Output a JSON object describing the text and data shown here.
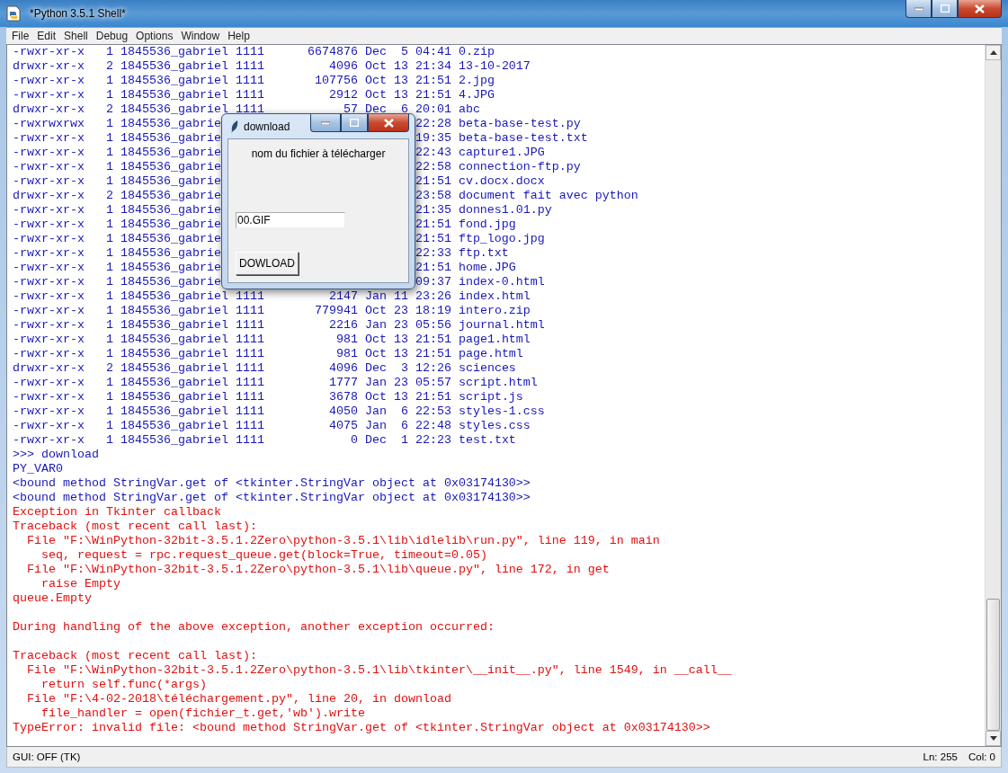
{
  "window": {
    "title": "*Python 3.5.1 Shell*"
  },
  "menu": [
    "File",
    "Edit",
    "Shell",
    "Debug",
    "Options",
    "Window",
    "Help"
  ],
  "shell": {
    "lines": [
      {
        "kind": "stdout",
        "text": "-rwxr-xr-x   1 1845536_gabriel 1111      6674876 Dec  5 04:41 0.zip"
      },
      {
        "kind": "stdout",
        "text": "drwxr-xr-x   2 1845536_gabriel 1111         4096 Oct 13 21:34 13-10-2017"
      },
      {
        "kind": "stdout",
        "text": "-rwxr-xr-x   1 1845536_gabriel 1111       107756 Oct 13 21:51 2.jpg"
      },
      {
        "kind": "stdout",
        "text": "-rwxr-xr-x   1 1845536_gabriel 1111         2912 Oct 13 21:51 4.JPG"
      },
      {
        "kind": "stdout",
        "text": "drwxr-xr-x   2 1845536_gabriel 1111           57 Dec  6 20:01 abc"
      },
      {
        "kind": "stdout",
        "segments": [
          "-rwxrwxrwx   1 1845536_gabrie",
          "22:28 beta-base-test.py"
        ]
      },
      {
        "kind": "stdout",
        "segments": [
          "-rwxr-xr-x   1 1845536_gabrie",
          "19:35 beta-base-test.txt"
        ]
      },
      {
        "kind": "stdout",
        "segments": [
          "-rwxr-xr-x   1 1845536_gabrie",
          "22:43 capture1.JPG"
        ]
      },
      {
        "kind": "stdout",
        "segments": [
          "-rwxr-xr-x   1 1845536_gabrie",
          "22:58 connection-ftp.py"
        ]
      },
      {
        "kind": "stdout",
        "segments": [
          "-rwxr-xr-x   1 1845536_gabrie",
          "21:51 cv.docx.docx"
        ]
      },
      {
        "kind": "stdout",
        "segments": [
          "drwxr-xr-x   2 1845536_gabrie",
          "23:58 document fait avec python"
        ]
      },
      {
        "kind": "stdout",
        "segments": [
          "-rwxr-xr-x   1 1845536_gabrie",
          "21:35 donnes1.01.py"
        ]
      },
      {
        "kind": "stdout",
        "segments": [
          "-rwxr-xr-x   1 1845536_gabrie",
          "21:51 fond.jpg"
        ]
      },
      {
        "kind": "stdout",
        "segments": [
          "-rwxr-xr-x   1 1845536_gabrie",
          "21:51 ftp_logo.jpg"
        ]
      },
      {
        "kind": "stdout",
        "segments": [
          "-rwxr-xr-x   1 1845536_gabrie",
          "22:33 ftp.txt"
        ]
      },
      {
        "kind": "stdout",
        "segments": [
          "-rwxr-xr-x   1 1845536_gabrie",
          "21:51 home.JPG"
        ]
      },
      {
        "kind": "stdout",
        "segments": [
          "-rwxr-xr-x   1 1845536_gabrie",
          "09:37 index-0.html"
        ]
      },
      {
        "kind": "stdout",
        "text": "-rwxr-xr-x   1 1845536_gabriel 1111         2147 Jan 11 23:26 index.html"
      },
      {
        "kind": "stdout",
        "text": "-rwxr-xr-x   1 1845536_gabriel 1111       779941 Oct 23 18:19 intero.zip"
      },
      {
        "kind": "stdout",
        "text": "-rwxr-xr-x   1 1845536_gabriel 1111         2216 Jan 23 05:56 journal.html"
      },
      {
        "kind": "stdout",
        "text": "-rwxr-xr-x   1 1845536_gabriel 1111          981 Oct 13 21:51 page1.html"
      },
      {
        "kind": "stdout",
        "text": "-rwxr-xr-x   1 1845536_gabriel 1111          981 Oct 13 21:51 page.html"
      },
      {
        "kind": "stdout",
        "text": "drwxr-xr-x   2 1845536_gabriel 1111         4096 Dec  3 12:26 sciences"
      },
      {
        "kind": "stdout",
        "text": "-rwxr-xr-x   1 1845536_gabriel 1111         1777 Jan 23 05:57 script.html"
      },
      {
        "kind": "stdout",
        "text": "-rwxr-xr-x   1 1845536_gabriel 1111         3678 Oct 13 21:51 script.js"
      },
      {
        "kind": "stdout",
        "text": "-rwxr-xr-x   1 1845536_gabriel 1111         4050 Jan  6 22:53 styles-1.css"
      },
      {
        "kind": "stdout",
        "text": "-rwxr-xr-x   1 1845536_gabriel 1111         4075 Jan  6 22:48 styles.css"
      },
      {
        "kind": "stdout",
        "text": "-rwxr-xr-x   1 1845536_gabriel 1111            0 Dec  1 22:23 test.txt"
      },
      {
        "kind": "prompt",
        "text": ">>> download"
      },
      {
        "kind": "stdout",
        "text": "PY_VAR0"
      },
      {
        "kind": "stdout",
        "text": "<bound method StringVar.get of <tkinter.StringVar object at 0x03174130>>"
      },
      {
        "kind": "stdout",
        "text": "<bound method StringVar.get of <tkinter.StringVar object at 0x03174130>>"
      },
      {
        "kind": "stderr",
        "text": "Exception in Tkinter callback"
      },
      {
        "kind": "stderr",
        "text": "Traceback (most recent call last):"
      },
      {
        "kind": "stderr",
        "text": "  File \"F:\\WinPython-32bit-3.5.1.2Zero\\python-3.5.1\\lib\\idlelib\\run.py\", line 119, in main"
      },
      {
        "kind": "stderr",
        "text": "    seq, request = rpc.request_queue.get(block=True, timeout=0.05)"
      },
      {
        "kind": "stderr",
        "text": "  File \"F:\\WinPython-32bit-3.5.1.2Zero\\python-3.5.1\\lib\\queue.py\", line 172, in get"
      },
      {
        "kind": "stderr",
        "text": "    raise Empty"
      },
      {
        "kind": "stderr",
        "text": "queue.Empty"
      },
      {
        "kind": "blank"
      },
      {
        "kind": "stderr",
        "text": "During handling of the above exception, another exception occurred:"
      },
      {
        "kind": "blank"
      },
      {
        "kind": "stderr",
        "text": "Traceback (most recent call last):"
      },
      {
        "kind": "stderr",
        "text": "  File \"F:\\WinPython-32bit-3.5.1.2Zero\\python-3.5.1\\lib\\tkinter\\__init__.py\", line 1549, in __call__"
      },
      {
        "kind": "stderr",
        "text": "    return self.func(*args)"
      },
      {
        "kind": "stderr",
        "text": "  File \"F:\\4-02-2018\\téléchargement.py\", line 20, in download"
      },
      {
        "kind": "stderr",
        "text": "    file_handler = open(fichier_t.get,'wb').write"
      },
      {
        "kind": "stderr",
        "text": "TypeError: invalid file: <bound method StringVar.get of <tkinter.StringVar object at 0x03174130>>"
      }
    ]
  },
  "dialog": {
    "title": "download",
    "label": "nom du fichier à télécharger",
    "input_value": "00.GIF",
    "button": "DOWLOAD"
  },
  "status_bar": {
    "left": "GUI: OFF (TK)",
    "line": "Ln: 255",
    "column": "Col: 0"
  }
}
